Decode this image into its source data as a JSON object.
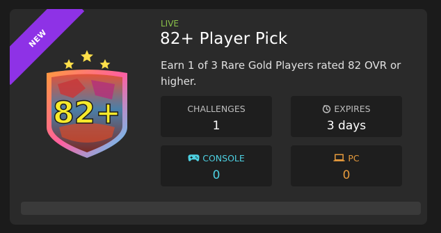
{
  "ribbon": {
    "label": "NEW"
  },
  "badge": {
    "rating_text": "82+",
    "stars": 3
  },
  "header": {
    "status": "LIVE",
    "title": "82+ Player Pick",
    "description": "Earn 1 of 3 Rare Gold Players rated 82 OVR or higher."
  },
  "stats": {
    "challenges": {
      "label": "CHALLENGES",
      "value": "1"
    },
    "expires": {
      "label": "EXPIRES",
      "value": "3 days",
      "icon": "timer-icon"
    },
    "console": {
      "label": "CONSOLE",
      "value": "0",
      "icon": "gamepad-icon"
    },
    "pc": {
      "label": "PC",
      "value": "0",
      "icon": "laptop-icon"
    }
  },
  "progress": {
    "percent": 0
  },
  "colors": {
    "live": "#8bc34a",
    "ribbon": "#8e32e6",
    "console": "#4dd0e1",
    "pc": "#e59a3c"
  }
}
